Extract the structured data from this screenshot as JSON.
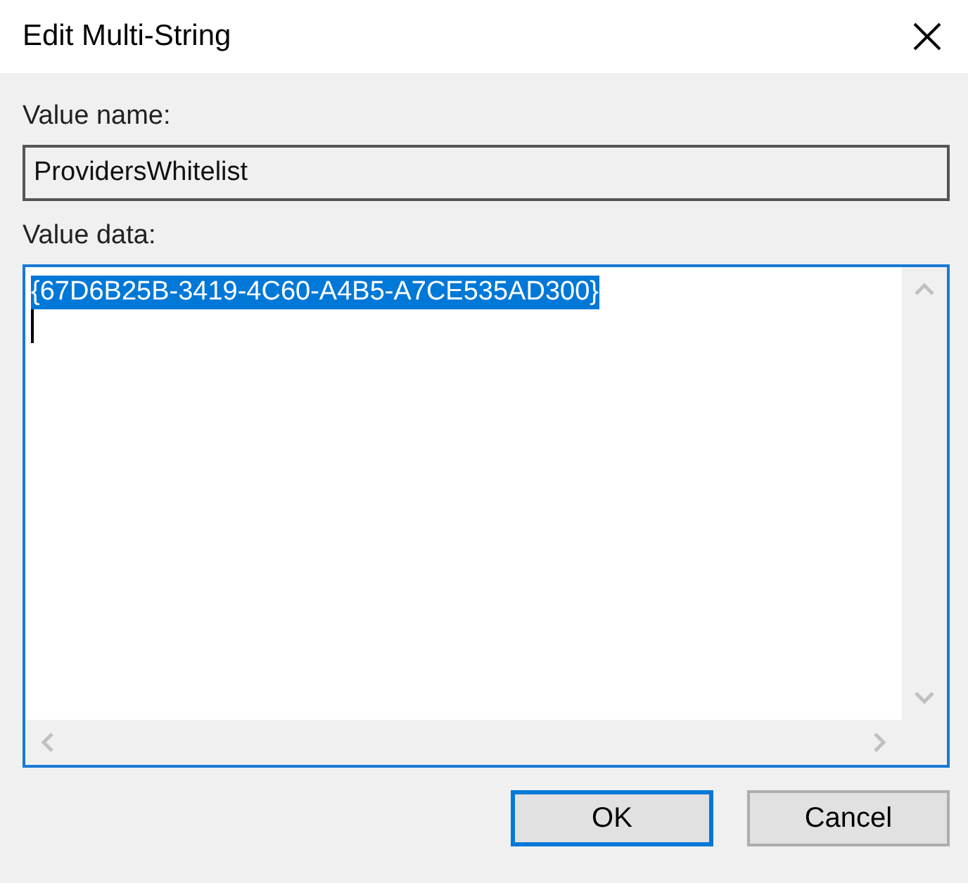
{
  "window": {
    "title": "Edit Multi-String"
  },
  "value_name": {
    "label": "Value name:",
    "value": "ProvidersWhitelist"
  },
  "value_data": {
    "label": "Value data:",
    "lines": [
      {
        "text": "{67D6B25B-3419-4C60-A4B5-A7CE535AD300}",
        "selected": true
      }
    ]
  },
  "buttons": [
    {
      "label": "OK",
      "default": true
    },
    {
      "label": "Cancel",
      "default": false
    }
  ]
}
